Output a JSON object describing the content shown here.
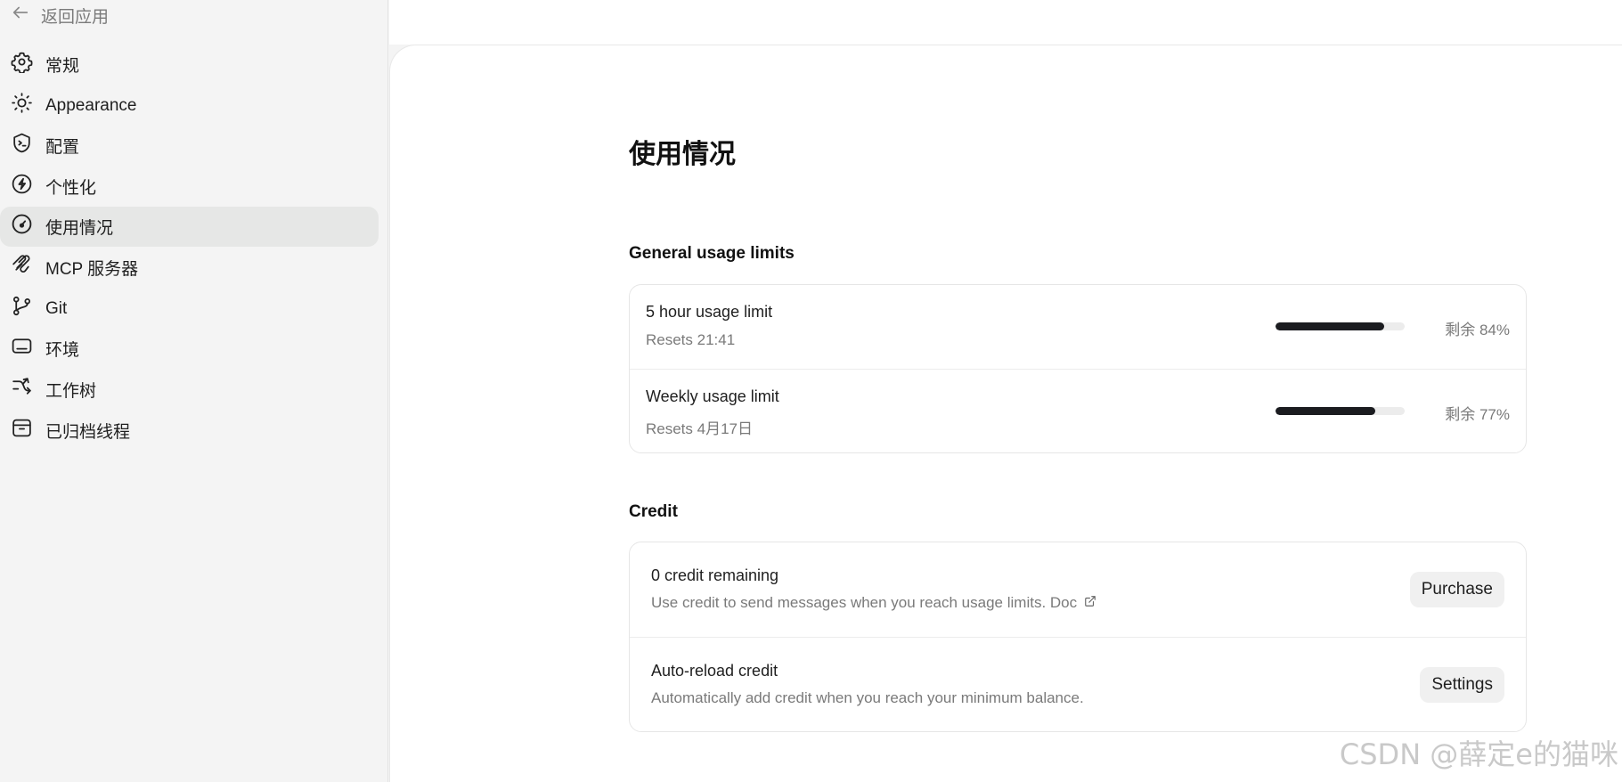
{
  "sidebar": {
    "back_label": "返回应用",
    "items": [
      {
        "label": "常规",
        "icon": "gear-icon"
      },
      {
        "label": "Appearance",
        "icon": "sun-icon"
      },
      {
        "label": "配置",
        "icon": "shield-terminal-icon"
      },
      {
        "label": "个性化",
        "icon": "personalize-icon"
      },
      {
        "label": "使用情况",
        "icon": "gauge-icon",
        "active": true
      },
      {
        "label": "MCP 服务器",
        "icon": "mcp-icon"
      },
      {
        "label": "Git",
        "icon": "git-branch-icon"
      },
      {
        "label": "环境",
        "icon": "monitor-icon"
      },
      {
        "label": "工作树",
        "icon": "worktree-icon"
      },
      {
        "label": "已归档线程",
        "icon": "archive-icon"
      }
    ]
  },
  "main": {
    "title": "使用情况",
    "usage_section": {
      "title": "General usage limits",
      "rows": [
        {
          "title": "5 hour usage limit",
          "subtitle": "Resets 21:41",
          "remaining_label": "剩余 84%",
          "remaining_fraction": 0.84
        },
        {
          "title": "Weekly usage limit",
          "subtitle": "Resets 4月17日",
          "remaining_label": "剩余 77%",
          "remaining_fraction": 0.77
        }
      ]
    },
    "credit_section": {
      "title": "Credit",
      "rows": [
        {
          "title": "0 credit remaining",
          "subtitle": "Use credit to send messages when you reach usage limits. Doc",
          "button": "Purchase",
          "link_icon": "external-link-icon"
        },
        {
          "title": "Auto-reload credit",
          "subtitle": "Automatically add credit when you reach your minimum balance.",
          "button": "Settings"
        }
      ]
    }
  },
  "watermark": "CSDN @薛定e的猫咪",
  "colors": {
    "sidebar_bg": "#f4f4f4",
    "active_item_bg": "#e6e7e6",
    "bar_fill": "#1b1c20",
    "bar_track": "#ececec"
  }
}
